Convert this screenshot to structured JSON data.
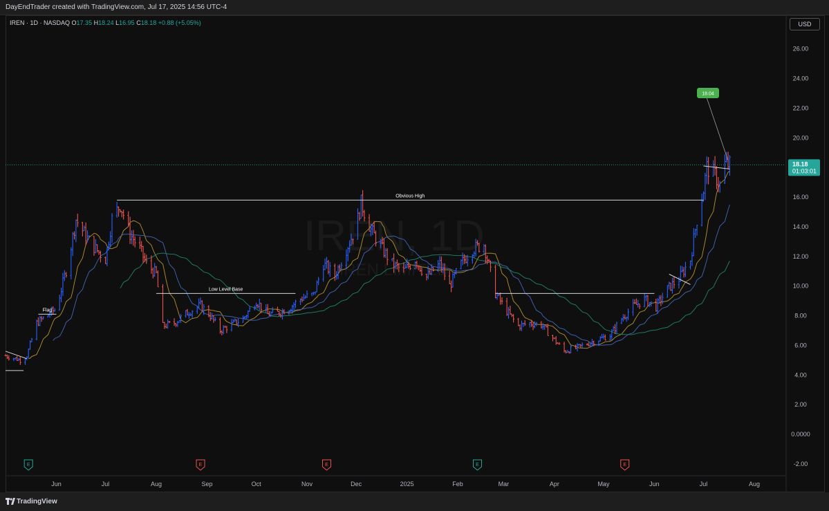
{
  "header": {
    "credit": "DayEndTrader created with TradingView.com, Jul 17, 2025 14:56 UTC-4"
  },
  "legend": {
    "symbol": "IREN · 1D · NASDAQ",
    "o_label": "O",
    "o": "17.35",
    "h_label": "H",
    "h": "18.24",
    "l_label": "L",
    "l": "16.95",
    "c_label": "C",
    "c": "18.18",
    "change": "+0.88 (+5.05%)"
  },
  "currency_button": "USD",
  "watermark": {
    "symbol": "IREN, 1D",
    "name": "IREN LIMITED"
  },
  "last_price": {
    "value": "18.18",
    "countdown": "01:03:01"
  },
  "footer": {
    "brand": "TradingView"
  },
  "colors": {
    "up": "#26a69a",
    "down": "#ef5350",
    "up_bar": "#2962ff",
    "accent_label": "#4caf50",
    "background": "#0f0f0f"
  },
  "chart_data": {
    "type": "ohlc",
    "title": "IREN · 1D · NASDAQ",
    "y_range": [
      -2.8,
      27.2
    ],
    "y_ticks": [
      "26.00",
      "24.00",
      "22.00",
      "20.00",
      "18.00",
      "16.00",
      "14.00",
      "12.00",
      "10.00",
      "8.00",
      "6.00",
      "4.00",
      "2.00",
      "0.0000",
      "-2.00"
    ],
    "x_range": [
      "2024-05-01",
      "2025-08-20"
    ],
    "x_ticks": [
      {
        "date": "2024-06-01",
        "label": "Jun"
      },
      {
        "date": "2024-07-01",
        "label": "Jul"
      },
      {
        "date": "2024-08-01",
        "label": "Aug"
      },
      {
        "date": "2024-09-01",
        "label": "Sep"
      },
      {
        "date": "2024-10-01",
        "label": "Oct"
      },
      {
        "date": "2024-11-01",
        "label": "Nov"
      },
      {
        "date": "2024-12-01",
        "label": "Dec"
      },
      {
        "date": "2025-01-01",
        "label": "2025"
      },
      {
        "date": "2025-02-01",
        "label": "Feb"
      },
      {
        "date": "2025-03-01",
        "label": "Mar"
      },
      {
        "date": "2025-04-01",
        "label": "Apr"
      },
      {
        "date": "2025-05-01",
        "label": "May"
      },
      {
        "date": "2025-06-01",
        "label": "Jun"
      },
      {
        "date": "2025-07-01",
        "label": "Jul"
      },
      {
        "date": "2025-08-01",
        "label": "Aug"
      }
    ],
    "price_path": [
      {
        "date": "2024-05-01",
        "close": 5.3
      },
      {
        "date": "2024-05-10",
        "close": 5.0
      },
      {
        "date": "2024-05-14",
        "close": 5.3
      },
      {
        "date": "2024-05-20",
        "close": 7.5
      },
      {
        "date": "2024-05-25",
        "close": 7.9
      },
      {
        "date": "2024-06-01",
        "close": 8.5
      },
      {
        "date": "2024-06-08",
        "close": 11.5
      },
      {
        "date": "2024-06-13",
        "close": 14.5
      },
      {
        "date": "2024-06-20",
        "close": 13.2
      },
      {
        "date": "2024-06-25",
        "close": 12.5
      },
      {
        "date": "2024-07-01",
        "close": 11.8
      },
      {
        "date": "2024-07-05",
        "close": 14.5
      },
      {
        "date": "2024-07-10",
        "close": 15.5
      },
      {
        "date": "2024-07-16",
        "close": 13.5
      },
      {
        "date": "2024-07-22",
        "close": 12.5
      },
      {
        "date": "2024-07-26",
        "close": 11.5
      },
      {
        "date": "2024-08-01",
        "close": 10.8
      },
      {
        "date": "2024-08-05",
        "close": 7.3
      },
      {
        "date": "2024-08-12",
        "close": 7.5
      },
      {
        "date": "2024-08-20",
        "close": 8.2
      },
      {
        "date": "2024-08-28",
        "close": 8.7
      },
      {
        "date": "2024-09-03",
        "close": 8.0
      },
      {
        "date": "2024-09-09",
        "close": 7.0
      },
      {
        "date": "2024-09-16",
        "close": 7.4
      },
      {
        "date": "2024-09-23",
        "close": 7.8
      },
      {
        "date": "2024-10-01",
        "close": 9.0
      },
      {
        "date": "2024-10-08",
        "close": 8.1
      },
      {
        "date": "2024-10-15",
        "close": 8.2
      },
      {
        "date": "2024-10-22",
        "close": 8.6
      },
      {
        "date": "2024-10-29",
        "close": 9.2
      },
      {
        "date": "2024-11-05",
        "close": 9.4
      },
      {
        "date": "2024-11-11",
        "close": 11.5
      },
      {
        "date": "2024-11-18",
        "close": 10.7
      },
      {
        "date": "2024-11-25",
        "close": 12.5
      },
      {
        "date": "2024-12-01",
        "close": 14.0
      },
      {
        "date": "2024-12-04",
        "close": 15.6
      },
      {
        "date": "2024-12-10",
        "close": 13.8
      },
      {
        "date": "2024-12-17",
        "close": 12.5
      },
      {
        "date": "2024-12-23",
        "close": 11.5
      },
      {
        "date": "2024-12-30",
        "close": 11.0
      },
      {
        "date": "2025-01-06",
        "close": 11.8
      },
      {
        "date": "2025-01-13",
        "close": 10.6
      },
      {
        "date": "2025-01-21",
        "close": 11.5
      },
      {
        "date": "2025-01-27",
        "close": 10.0
      },
      {
        "date": "2025-02-03",
        "close": 11.5
      },
      {
        "date": "2025-02-10",
        "close": 12.5
      },
      {
        "date": "2025-02-17",
        "close": 12.8
      },
      {
        "date": "2025-02-24",
        "close": 9.5
      },
      {
        "date": "2025-03-03",
        "close": 8.3
      },
      {
        "date": "2025-03-10",
        "close": 7.3
      },
      {
        "date": "2025-03-17",
        "close": 7.5
      },
      {
        "date": "2025-03-24",
        "close": 7.4
      },
      {
        "date": "2025-03-31",
        "close": 6.5
      },
      {
        "date": "2025-04-07",
        "close": 5.6
      },
      {
        "date": "2025-04-14",
        "close": 5.8
      },
      {
        "date": "2025-04-21",
        "close": 6.1
      },
      {
        "date": "2025-04-28",
        "close": 6.4
      },
      {
        "date": "2025-05-05",
        "close": 6.7
      },
      {
        "date": "2025-05-12",
        "close": 7.8
      },
      {
        "date": "2025-05-19",
        "close": 8.6
      },
      {
        "date": "2025-05-26",
        "close": 9.1
      },
      {
        "date": "2025-06-02",
        "close": 8.6
      },
      {
        "date": "2025-06-09",
        "close": 9.8
      },
      {
        "date": "2025-06-16",
        "close": 10.5
      },
      {
        "date": "2025-06-23",
        "close": 11.8
      },
      {
        "date": "2025-06-27",
        "close": 14.5
      },
      {
        "date": "2025-07-01",
        "close": 16.5
      },
      {
        "date": "2025-07-03",
        "close": 18.0
      },
      {
        "date": "2025-07-08",
        "close": 17.5
      },
      {
        "date": "2025-07-11",
        "close": 16.8
      },
      {
        "date": "2025-07-14",
        "close": 18.2
      },
      {
        "date": "2025-07-17",
        "close": 18.18
      }
    ],
    "annotations": [
      {
        "text": "Obvious High",
        "price": 15.8,
        "from": "2024-07-08",
        "to": "2025-07-01"
      },
      {
        "text": "Low Level Base",
        "price": 9.5,
        "from": "2024-08-01",
        "to": "2024-10-25"
      },
      {
        "text": "",
        "price": 9.5,
        "from": "2025-02-24",
        "to": "2025-06-01"
      },
      {
        "text": "Flag",
        "price": 8.1,
        "from": "2024-05-21",
        "to": "2024-06-01"
      },
      {
        "text": "18.04",
        "price": 18.04
      }
    ],
    "earnings_markers": [
      {
        "date": "2024-05-15",
        "type": "past"
      },
      {
        "date": "2024-08-28",
        "type": "future"
      },
      {
        "date": "2024-11-13",
        "type": "future"
      },
      {
        "date": "2025-02-13",
        "type": "past"
      },
      {
        "date": "2025-05-14",
        "type": "future"
      }
    ]
  }
}
